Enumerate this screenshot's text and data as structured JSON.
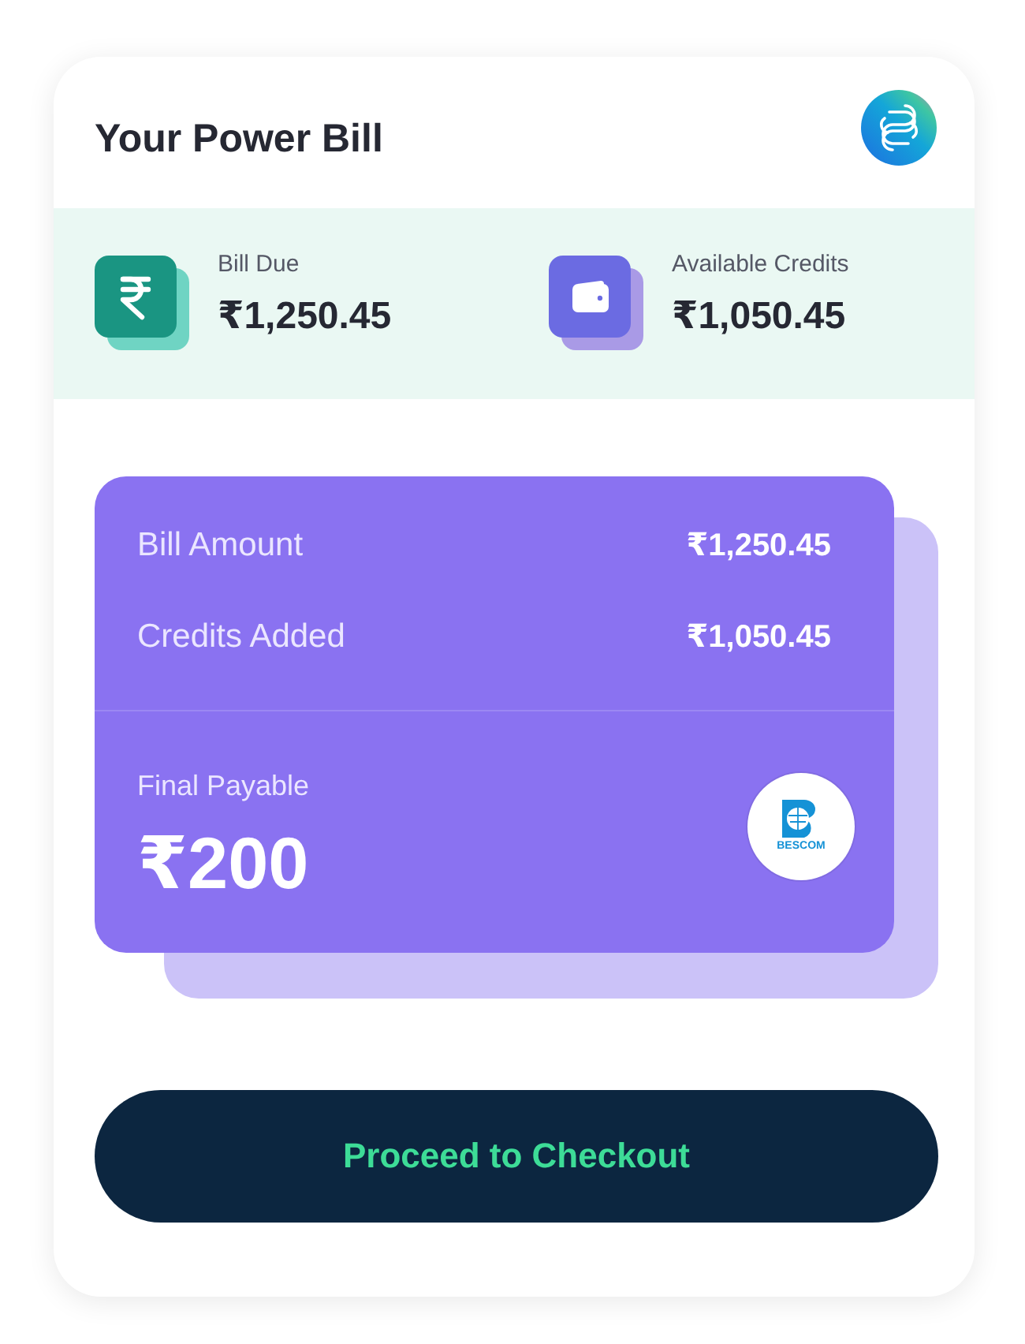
{
  "header": {
    "title": "Your Power Bill"
  },
  "summary": [
    {
      "kind": "bill",
      "label": "Bill Due",
      "amount": "₹1,250.45"
    },
    {
      "kind": "credits",
      "label": "Available Credits",
      "amount": "₹1,050.45"
    }
  ],
  "breakdown": {
    "rows": [
      {
        "label": "Bill Amount",
        "value": "₹1,250.45"
      },
      {
        "label": "Credits Added",
        "value": "₹1,050.45"
      }
    ],
    "final": {
      "label": "Final Payable",
      "amount": "₹200"
    },
    "provider_logo": {
      "text": "BESCOM"
    }
  },
  "checkout_button": {
    "label": "Proceed to Checkout"
  }
}
